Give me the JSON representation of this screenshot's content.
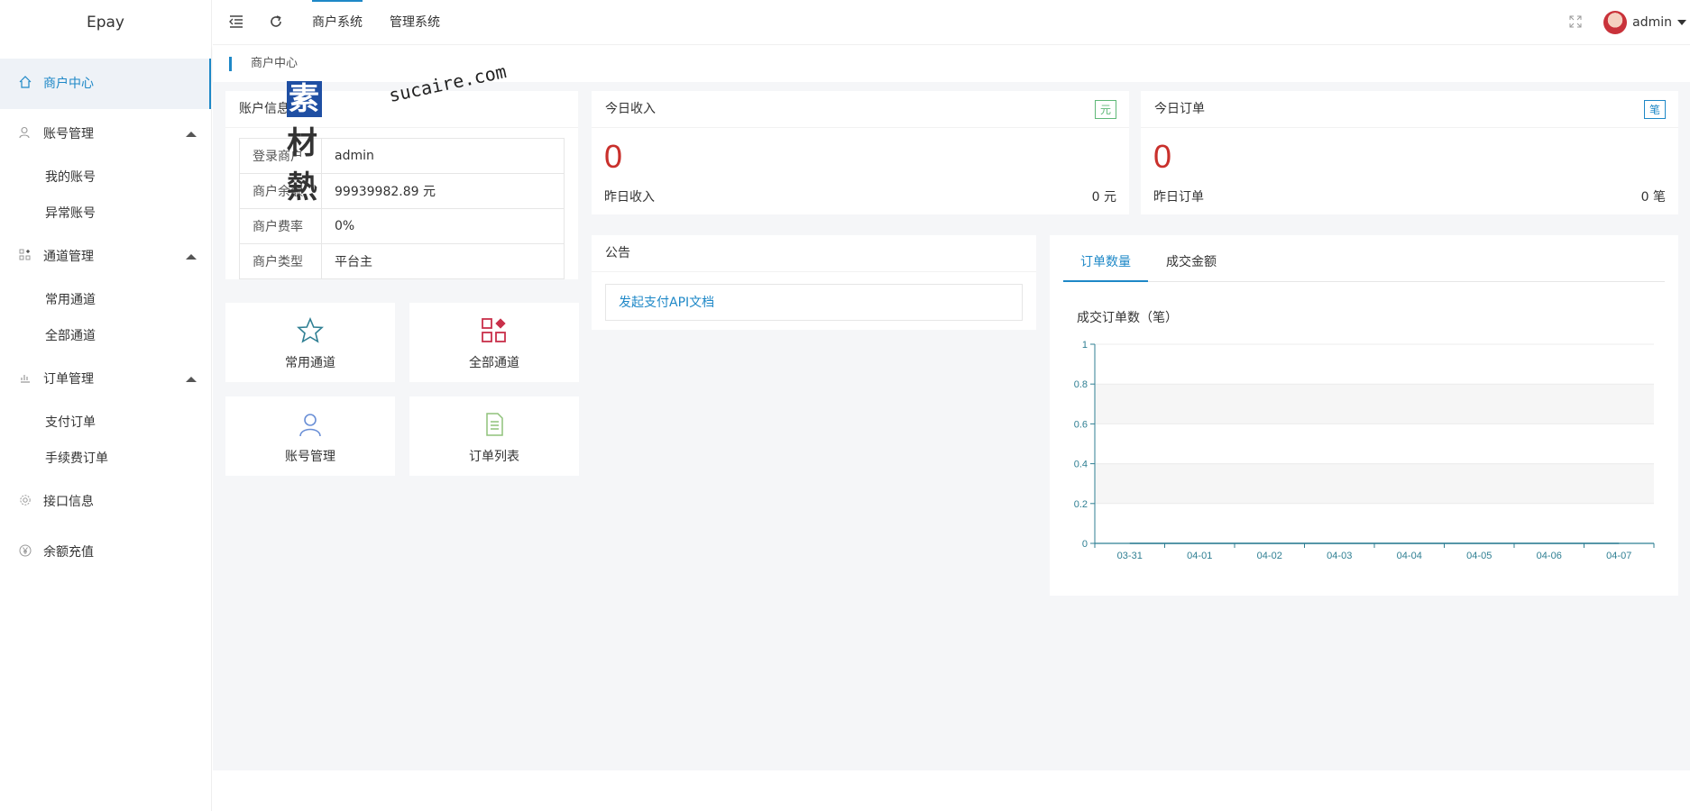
{
  "app": {
    "logo": "Epay"
  },
  "sidebar": {
    "items": [
      {
        "label": "商户中心",
        "icon": "home-icon"
      },
      {
        "label": "账号管理",
        "icon": "user-icon",
        "children": [
          "我的账号",
          "异常账号"
        ]
      },
      {
        "label": "通道管理",
        "icon": "grid-icon",
        "children": [
          "常用通道",
          "全部通道"
        ]
      },
      {
        "label": "订单管理",
        "icon": "chart-icon",
        "children": [
          "支付订单",
          "手续费订单"
        ]
      },
      {
        "label": "接口信息",
        "icon": "gear-icon"
      },
      {
        "label": "余额充值",
        "icon": "yen-icon"
      }
    ]
  },
  "header": {
    "tabs": [
      "商户系统",
      "管理系统"
    ],
    "user": "admin"
  },
  "breadcrumb": "商户中心",
  "watermark": {
    "cn": "素材熱",
    "en": "sucaire.com"
  },
  "account": {
    "title": "账户信息",
    "rows": [
      {
        "k": "登录商户",
        "v": "admin"
      },
      {
        "k": "商户余额",
        "v": "99939982.89 元"
      },
      {
        "k": "商户费率",
        "v": "0%"
      },
      {
        "k": "商户类型",
        "v": "平台主"
      }
    ]
  },
  "quick": [
    "常用通道",
    "全部通道",
    "账号管理",
    "订单列表"
  ],
  "income": {
    "title": "今日收入",
    "badge": "元",
    "value": "0",
    "sub_label": "昨日收入",
    "sub_value": "0 元"
  },
  "orders": {
    "title": "今日订单",
    "badge": "笔",
    "value": "0",
    "sub_label": "昨日订单",
    "sub_value": "0 笔"
  },
  "notice": {
    "title": "公告",
    "link": "发起支付API文档"
  },
  "chart_panel": {
    "tabs": [
      "订单数量",
      "成交金额"
    ]
  },
  "colors": {
    "accent": "#1e88c7",
    "red": "#c9302c",
    "green": "#5fb878",
    "chart_axis": "#2f7f93"
  },
  "chart_data": {
    "type": "line",
    "title": "成交订单数（笔）",
    "categories": [
      "03-31",
      "04-01",
      "04-02",
      "04-03",
      "04-04",
      "04-05",
      "04-06",
      "04-07"
    ],
    "series": [
      {
        "values": [
          0,
          0,
          0,
          0,
          0,
          0,
          0,
          0
        ]
      }
    ],
    "yticks": [
      "0",
      "0.2",
      "0.4",
      "0.6",
      "0.8",
      "1"
    ],
    "ylim": [
      0,
      1
    ],
    "grid": true
  }
}
